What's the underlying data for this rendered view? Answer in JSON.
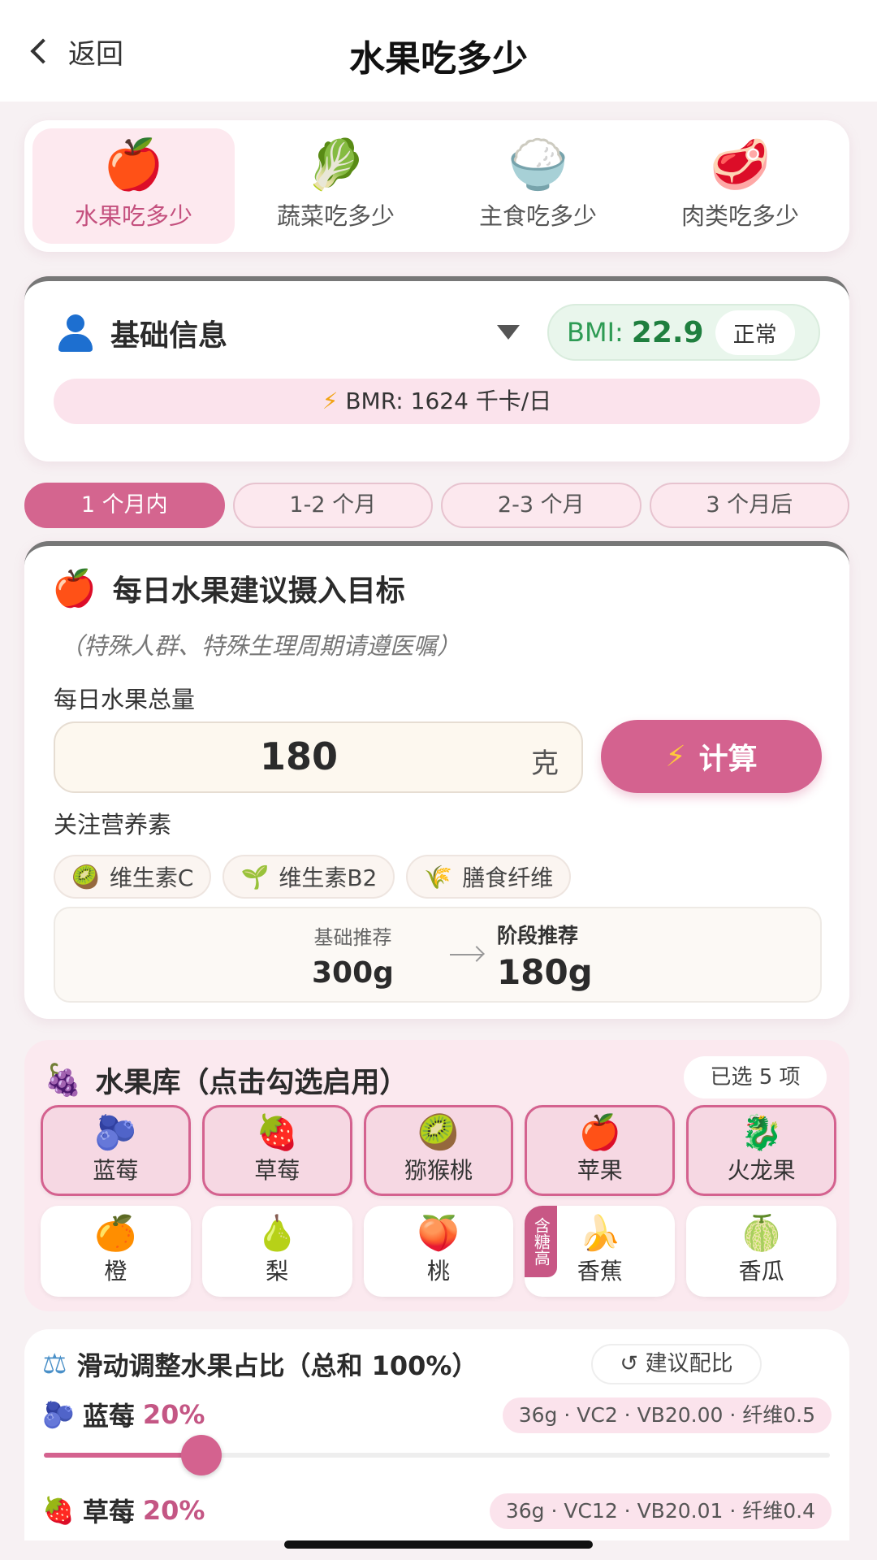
{
  "nav": {
    "back_label": "返回",
    "title": "水果吃多少"
  },
  "tabs": [
    {
      "label": "水果吃多少",
      "icon": "🍎",
      "icon_name": "apple-icon",
      "active": true
    },
    {
      "label": "蔬菜吃多少",
      "icon": "🥬",
      "icon_name": "vegetable-icon",
      "active": false
    },
    {
      "label": "主食吃多少",
      "icon": "🍚",
      "icon_name": "rice-bowl-icon",
      "active": false
    },
    {
      "label": "肉类吃多少",
      "icon": "🥩",
      "icon_name": "meat-icon",
      "active": false
    }
  ],
  "basic_info": {
    "title": "基础信息",
    "bmi_label": "BMI:",
    "bmi_value": "22.9",
    "bmi_status": "正常",
    "bmr_text": "BMR: 1624 千卡/日"
  },
  "periods": [
    "1 个月内",
    "1-2 个月",
    "2-3 个月",
    "3 个月后"
  ],
  "target": {
    "title": "每日水果建议摄入目标",
    "note": "（特殊人群、特殊生理周期请遵医嘱）",
    "total_label": "每日水果总量",
    "total_value": "180",
    "unit": "克",
    "calc_label": "计算",
    "nutrients_label": "关注营养素",
    "nutrients": [
      {
        "icon": "🥝",
        "label": "维生素C"
      },
      {
        "icon": "🌱",
        "label": "维生素B2"
      },
      {
        "icon": "🌾",
        "label": "膳食纤维"
      }
    ],
    "base_label": "基础推荐",
    "base_value": "300g",
    "stage_label": "阶段推荐",
    "stage_value": "180g"
  },
  "library": {
    "title": "水果库（点击勾选启用）",
    "selected_count": "已选 5 项",
    "fruits": [
      {
        "name": "蓝莓",
        "icon": "🫐",
        "icon_name": "blueberry-icon",
        "selected": true
      },
      {
        "name": "草莓",
        "icon": "🍓",
        "icon_name": "strawberry-icon",
        "selected": true
      },
      {
        "name": "猕猴桃",
        "icon": "🥝",
        "icon_name": "kiwi-icon",
        "selected": true
      },
      {
        "name": "苹果",
        "icon": "🍎",
        "icon_name": "apple-icon",
        "selected": true
      },
      {
        "name": "火龙果",
        "icon": "🐉",
        "icon_name": "dragonfruit-icon",
        "selected": true
      },
      {
        "name": "橙",
        "icon": "🍊",
        "icon_name": "orange-icon",
        "selected": false
      },
      {
        "name": "梨",
        "icon": "🍐",
        "icon_name": "pear-icon",
        "selected": false
      },
      {
        "name": "桃",
        "icon": "🍑",
        "icon_name": "peach-icon",
        "selected": false
      },
      {
        "name": "香蕉",
        "icon": "🍌",
        "icon_name": "banana-icon",
        "selected": false,
        "badge": "含糖高"
      },
      {
        "name": "香瓜",
        "icon": "🍈",
        "icon_name": "melon-icon",
        "selected": false
      }
    ]
  },
  "ratio": {
    "title": "滑动调整水果占比（总和 100%）",
    "suggest_label": "建议配比",
    "items": [
      {
        "name": "蓝莓",
        "icon": "🫐",
        "pct": "20%",
        "info": "36g · VC2 · VB20.00 · 纤维0.5",
        "slider_fraction": 0.2
      },
      {
        "name": "草莓",
        "icon": "🍓",
        "pct": "20%",
        "info": "36g · VC12 · VB20.01 · 纤维0.4"
      }
    ]
  }
}
